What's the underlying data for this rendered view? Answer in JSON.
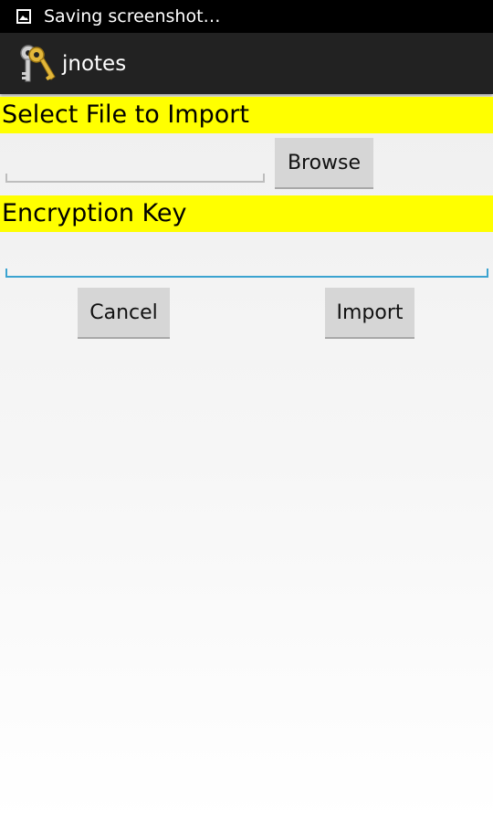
{
  "status_bar": {
    "icon": "image-icon",
    "text": "Saving screenshot…"
  },
  "action_bar": {
    "icon": "keys-icon",
    "title": "jnotes"
  },
  "import_section": {
    "header": "Select File to Import",
    "file_value": "",
    "browse_label": "Browse"
  },
  "key_section": {
    "header": "Encryption Key",
    "key_value": ""
  },
  "actions": {
    "cancel_label": "Cancel",
    "import_label": "Import"
  },
  "colors": {
    "header_bg": "#ffff00",
    "focus_underline": "#3ba3d0",
    "action_bar_bg": "#222222",
    "status_bar_bg": "#000000"
  }
}
